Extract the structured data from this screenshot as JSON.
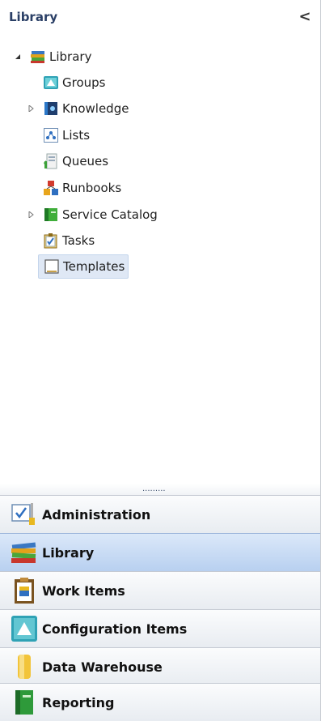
{
  "header": {
    "title": "Library",
    "collapse_glyph": "<"
  },
  "tree": {
    "root": {
      "label": "Library",
      "icon": "books-icon",
      "expanded": true
    },
    "items": [
      {
        "label": "Groups",
        "icon": "groups-icon",
        "expandable": false
      },
      {
        "label": "Knowledge",
        "icon": "knowledge-icon",
        "expandable": true
      },
      {
        "label": "Lists",
        "icon": "lists-icon",
        "expandable": false
      },
      {
        "label": "Queues",
        "icon": "queues-icon",
        "expandable": false
      },
      {
        "label": "Runbooks",
        "icon": "runbooks-icon",
        "expandable": false
      },
      {
        "label": "Service Catalog",
        "icon": "service-catalog-icon",
        "expandable": true
      },
      {
        "label": "Tasks",
        "icon": "tasks-icon",
        "expandable": false
      },
      {
        "label": "Templates",
        "icon": "templates-icon",
        "expandable": false,
        "selected": true
      }
    ]
  },
  "splitter": {
    "grip": "........."
  },
  "wunderbar": [
    {
      "label": "Administration",
      "icon": "administration-icon",
      "active": false
    },
    {
      "label": "Library",
      "icon": "library-books-icon",
      "active": true
    },
    {
      "label": "Work Items",
      "icon": "work-items-icon",
      "active": false
    },
    {
      "label": "Configuration Items",
      "icon": "configuration-items-icon",
      "active": false
    },
    {
      "label": "Data Warehouse",
      "icon": "data-warehouse-icon",
      "active": false
    },
    {
      "label": "Reporting",
      "icon": "reporting-icon",
      "active": false
    }
  ],
  "colors": {
    "active_tab": "#b8d0f0",
    "selection": "#dfe8f5",
    "title": "#2a3f66"
  }
}
